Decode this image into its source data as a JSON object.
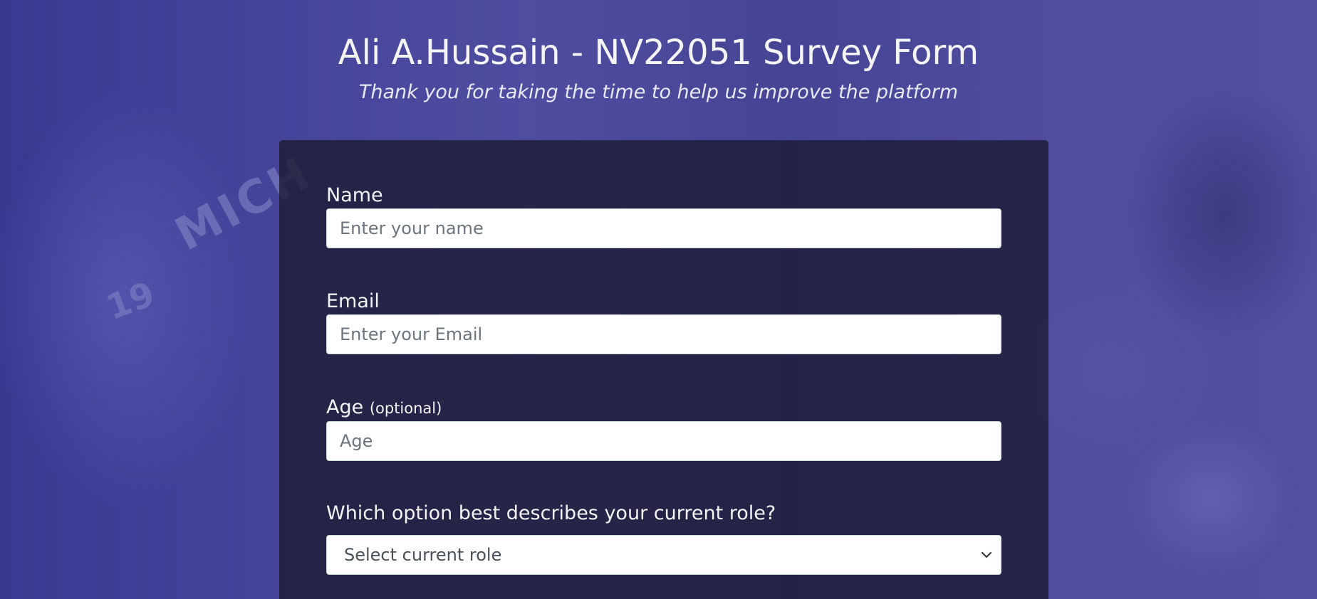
{
  "header": {
    "title": "Ali A.Hussain - NV22051 Survey Form",
    "description": "Thank you for taking the time to help us improve the platform"
  },
  "form": {
    "name": {
      "label": "Name",
      "placeholder": "Enter your name"
    },
    "email": {
      "label": "Email",
      "placeholder": "Enter your Email"
    },
    "age": {
      "label": "Age",
      "clue": "(optional)",
      "placeholder": "Age"
    },
    "role": {
      "label": "Which option best describes your current role?",
      "selected": "Select current role"
    }
  },
  "background": {
    "jersey_text": "MICH",
    "jersey_number": "19"
  },
  "colors": {
    "background_tint": "#4a4a9c",
    "form_background": "#1b1b32",
    "input_background": "#ffffff",
    "input_border": "#ced4da"
  }
}
